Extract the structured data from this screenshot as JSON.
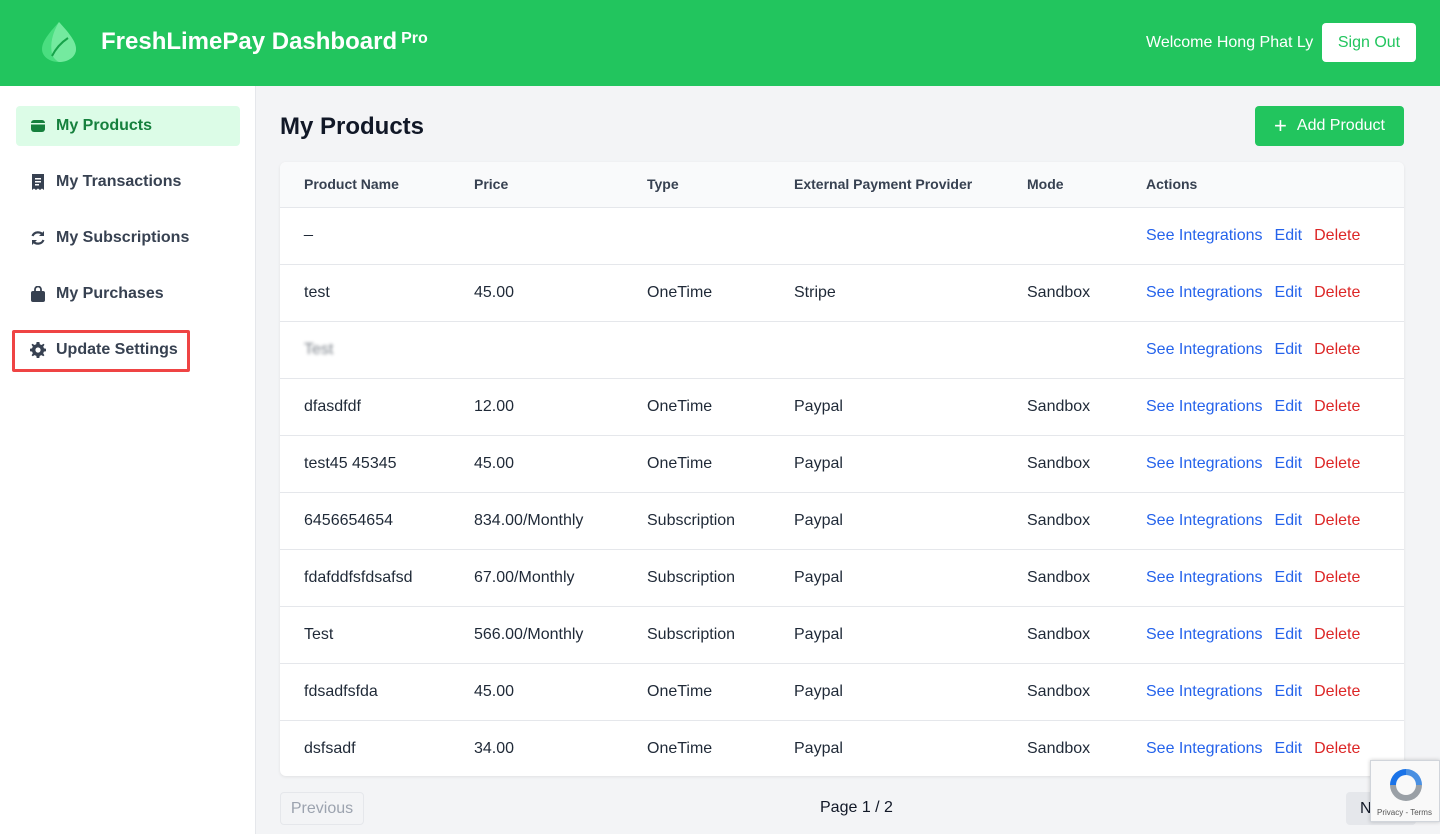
{
  "header": {
    "brand": "FreshLimePay Dashboard",
    "brand_badge": "Pro",
    "welcome": "Welcome Hong Phat Ly",
    "signout_label": "Sign Out"
  },
  "sidebar": {
    "items": [
      {
        "label": "My Products",
        "icon": "box-icon",
        "active": true
      },
      {
        "label": "My Transactions",
        "icon": "receipt-icon"
      },
      {
        "label": "My Subscriptions",
        "icon": "refresh-icon"
      },
      {
        "label": "My Purchases",
        "icon": "shopping-bag-icon"
      },
      {
        "label": "Update Settings",
        "icon": "gear-icon",
        "highlighted": true
      }
    ]
  },
  "main": {
    "title": "My Products",
    "add_button": "Add Product",
    "columns": [
      "Product Name",
      "Price",
      "Type",
      "External Payment Provider",
      "Mode",
      "Actions"
    ],
    "rows": [
      {
        "name": "_",
        "price": "",
        "type": "",
        "provider": "",
        "mode": ""
      },
      {
        "name": "test",
        "price": "45.00",
        "type": "OneTime",
        "provider": "Stripe",
        "mode": "Sandbox"
      },
      {
        "name": "Test",
        "price": "",
        "type": "",
        "provider": "",
        "mode": ""
      },
      {
        "name": "dfasdfdf",
        "price": "12.00",
        "type": "OneTime",
        "provider": "Paypal",
        "mode": "Sandbox"
      },
      {
        "name": "test45 45345",
        "price": "45.00",
        "type": "OneTime",
        "provider": "Paypal",
        "mode": "Sandbox"
      },
      {
        "name": "6456654654",
        "price": "834.00/Monthly",
        "type": "Subscription",
        "provider": "Paypal",
        "mode": "Sandbox"
      },
      {
        "name": "fdafddfsfdsafsd",
        "price": "67.00/Monthly",
        "type": "Subscription",
        "provider": "Paypal",
        "mode": "Sandbox"
      },
      {
        "name": "Test",
        "price": "566.00/Monthly",
        "type": "Subscription",
        "provider": "Paypal",
        "mode": "Sandbox"
      },
      {
        "name": "fdsadfsfda",
        "price": "45.00",
        "type": "OneTime",
        "provider": "Paypal",
        "mode": "Sandbox"
      },
      {
        "name": "dsfsadf",
        "price": "34.00",
        "type": "OneTime",
        "provider": "Paypal",
        "mode": "Sandbox"
      }
    ],
    "actions": {
      "integrations": "See Integrations",
      "edit": "Edit",
      "delete": "Delete"
    }
  },
  "pagination": {
    "previous": "Previous",
    "page_info": "Page 1 / 2",
    "next": "N"
  },
  "recaptcha": {
    "text": "Privacy - Terms"
  },
  "colors": {
    "brand": "#22c55e",
    "active_bg": "#dcfce7",
    "link": "#2563eb",
    "danger": "#dc2626",
    "highlight": "#ef4444"
  }
}
